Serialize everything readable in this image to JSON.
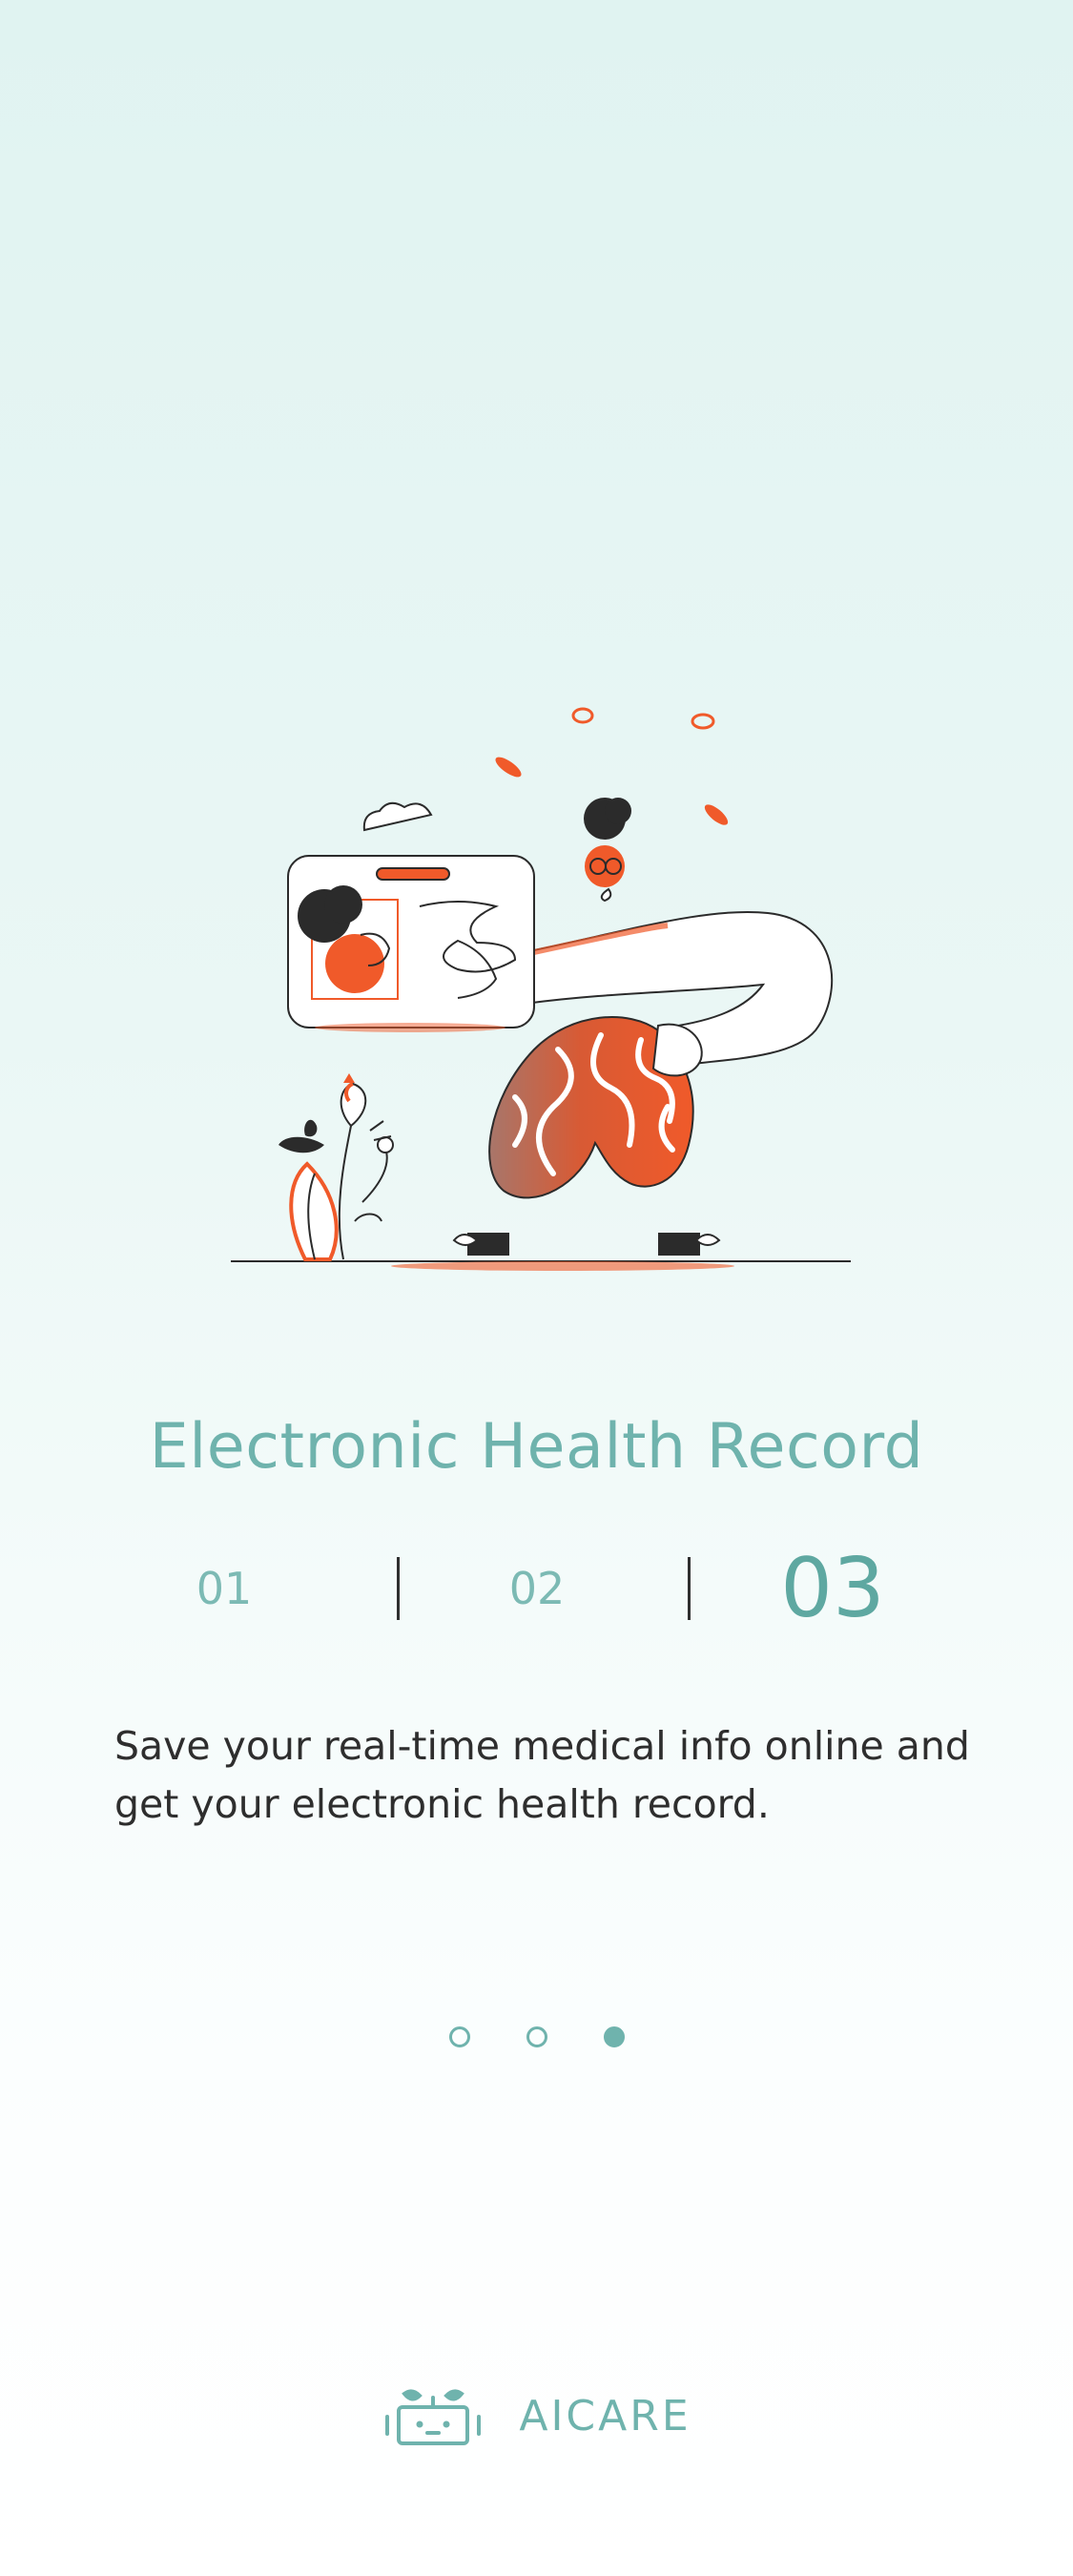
{
  "colors": {
    "accent": "#6fb3ad",
    "illustration_orange": "#f05a2a",
    "text_dark": "#2e2e2e"
  },
  "illustration": {
    "subject": "person holding an ID card with a plant beside"
  },
  "title": "Electronic Health Record",
  "steps": [
    {
      "label": "01",
      "active": false
    },
    {
      "label": "02",
      "active": false
    },
    {
      "label": "03",
      "active": true
    }
  ],
  "description": "Save your real-time medical info online and get your electronic health record.",
  "pager": {
    "count": 3,
    "active_index": 2
  },
  "brand": {
    "name": "AICARE",
    "icon": "robot-logo-icon"
  }
}
